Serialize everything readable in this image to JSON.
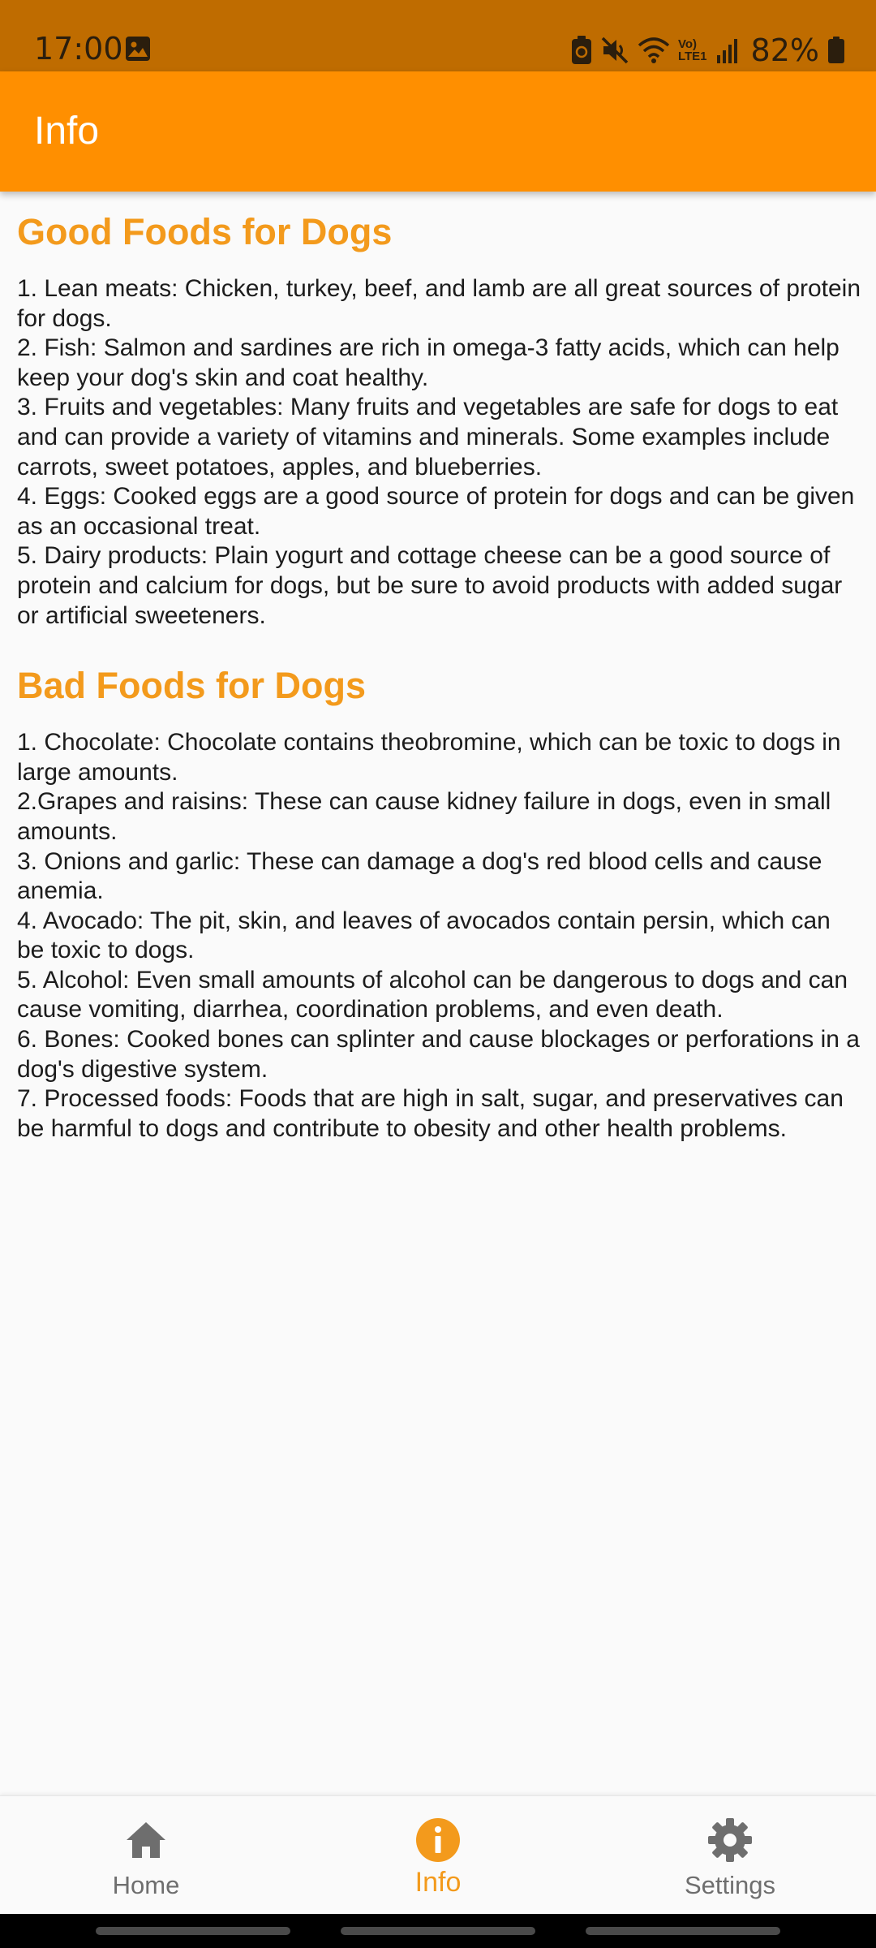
{
  "status_bar": {
    "time": "17:00",
    "battery": "82%",
    "icons": [
      "gallery-icon",
      "battery-saver-icon",
      "mute-icon",
      "wifi-icon",
      "volte-icon",
      "signal-icon",
      "battery-icon"
    ],
    "volte_label": "Vo)",
    "lte_label": "LTE1"
  },
  "app_bar": {
    "title": "Info"
  },
  "good_foods": {
    "title": "Good Foods for Dogs",
    "lines": [
      "1. Lean meats: Chicken, turkey, beef, and lamb are all great sources of protein for dogs.",
      "2. Fish: Salmon and sardines are rich in omega-3 fatty acids, which can help keep your dog's skin and coat healthy.",
      "3. Fruits and vegetables: Many fruits and vegetables are safe for dogs to eat and can provide a variety of vitamins and minerals. Some examples include carrots, sweet potatoes, apples, and blueberries.",
      "4. Eggs: Cooked eggs are a good source of protein for dogs and can be given as an occasional treat.",
      "5. Dairy products: Plain yogurt and cottage cheese can be a good source of protein and calcium for dogs, but be sure to avoid products with added sugar or artificial sweeteners."
    ]
  },
  "bad_foods": {
    "title": "Bad Foods for Dogs",
    "lines": [
      "1. Chocolate: Chocolate contains theobromine, which can be toxic to dogs in large amounts.",
      "2.Grapes and raisins: These can cause kidney failure in dogs, even in small amounts.",
      "3. Onions and garlic: These can damage a dog's red blood cells and cause anemia.",
      "4. Avocado: The pit, skin, and leaves of avocados contain persin, which can be toxic to dogs.",
      "5. Alcohol: Even small amounts of alcohol can be dangerous to dogs and can cause vomiting, diarrhea, coordination problems, and even death.",
      "6. Bones: Cooked bones can splinter and cause blockages or perforations in a dog's digestive system.",
      "7. Processed foods: Foods that are high in salt, sugar, and preservatives can be harmful to dogs and contribute to obesity and other health problems."
    ]
  },
  "bottom_nav": {
    "items": [
      {
        "label": "Home",
        "icon": "home-icon",
        "active": false
      },
      {
        "label": "Info",
        "icon": "info-icon",
        "active": true
      },
      {
        "label": "Settings",
        "icon": "gear-icon",
        "active": false
      }
    ]
  },
  "colors": {
    "status_bar": "#bf6c00",
    "app_bar": "#ff8f00",
    "accent": "#f39a1c",
    "inactive_nav": "#6e6e6e",
    "background": "#fafafa"
  }
}
